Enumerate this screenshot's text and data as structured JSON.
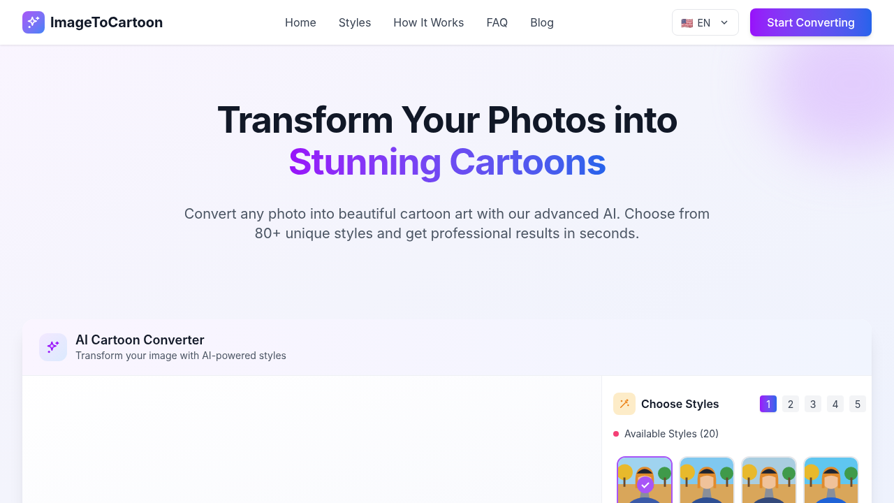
{
  "brand": {
    "name": "ImageToCartoon"
  },
  "nav": [
    {
      "label": "Home"
    },
    {
      "label": "Styles"
    },
    {
      "label": "How It Works"
    },
    {
      "label": "FAQ"
    },
    {
      "label": "Blog"
    }
  ],
  "language": {
    "flag": "🇺🇸",
    "code": "EN"
  },
  "cta": "Start Converting",
  "hero": {
    "title": "Transform Your Photos into",
    "highlight": "Stunning Cartoons",
    "subtitle": "Convert any photo into beautiful cartoon art with our advanced AI. Choose from 80+ unique styles and get professional results in seconds."
  },
  "converter": {
    "title": "AI Cartoon Converter",
    "subtitle": "Transform your image with AI-powered styles"
  },
  "styles_panel": {
    "title": "Choose Styles",
    "pages": [
      {
        "label": "1",
        "selected": true
      },
      {
        "label": "2",
        "selected": false
      },
      {
        "label": "3",
        "selected": false
      },
      {
        "label": "4",
        "selected": false
      },
      {
        "label": "5",
        "selected": false
      }
    ],
    "available": {
      "label": "Available Styles (20)",
      "color": "#f43f75"
    },
    "styles": [
      {
        "kind": "picture",
        "selected": true
      },
      {
        "kind": "picture",
        "selected": false
      },
      {
        "kind": "picture",
        "selected": false
      },
      {
        "kind": "picture",
        "selected": false
      }
    ]
  }
}
